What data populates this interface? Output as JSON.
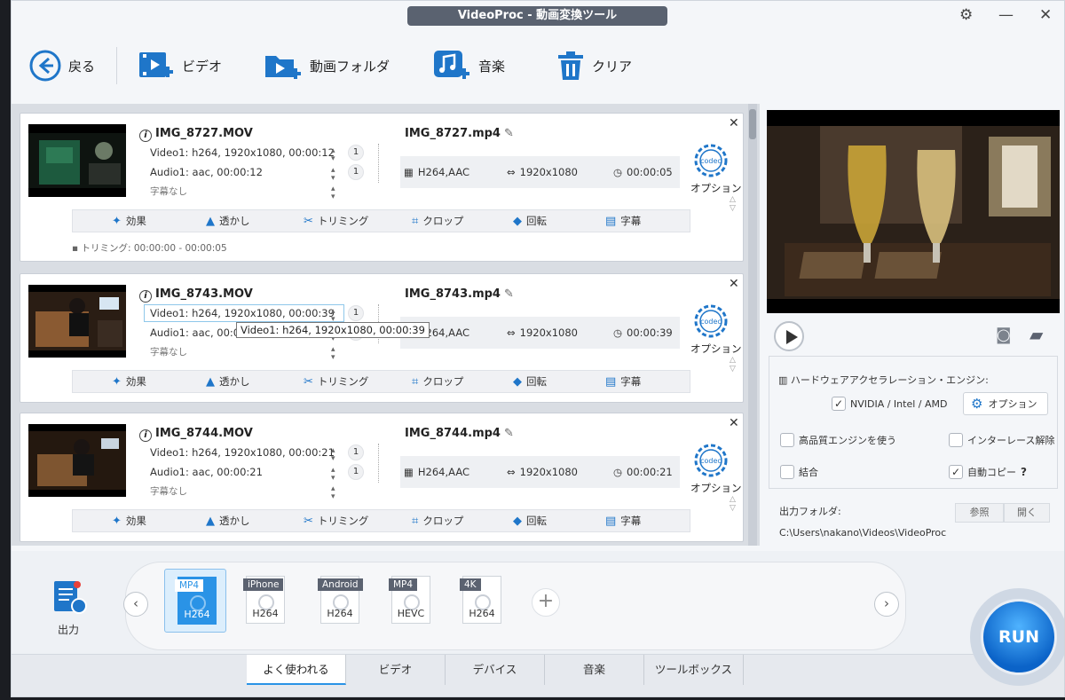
{
  "window": {
    "title": "VideoProc - 動画変換ツール"
  },
  "toolbar": {
    "back": "戻る",
    "video": "ビデオ",
    "folder": "動画フォルダ",
    "music": "音楽",
    "clear": "クリア"
  },
  "actions": {
    "effect": "効果",
    "watermark": "透かし",
    "trim": "トリミング",
    "crop": "クロップ",
    "rotate": "回転",
    "subtitle": "字幕"
  },
  "option_label": "オプション",
  "items": [
    {
      "src_name": "IMG_8727.MOV",
      "video": "Video1: h264, 1920x1080, 00:00:12",
      "audio": "Audio1: aac, 00:00:12",
      "subs": "字幕なし",
      "video_count": "1",
      "audio_count": "1",
      "out_name": "IMG_8727.mp4",
      "codec": "H264,AAC",
      "resolution": "1920x1080",
      "duration": "00:00:05",
      "trim_note": "トリミング: 00:00:00 - 00:00:05"
    },
    {
      "src_name": "IMG_8743.MOV",
      "video": "Video1: h264, 1920x1080, 00:00:39",
      "audio": "Audio1: aac, 00:00:39",
      "subs": "字幕なし",
      "video_count": "1",
      "audio_count": "1",
      "out_name": "IMG_8743.mp4",
      "codec": "H264,AAC",
      "resolution": "1920x1080",
      "duration": "00:00:39",
      "tooltip": "Video1: h264, 1920x1080, 00:00:39"
    },
    {
      "src_name": "IMG_8744.MOV",
      "video": "Video1: h264, 1920x1080, 00:00:21",
      "audio": "Audio1: aac, 00:00:21",
      "subs": "字幕なし",
      "video_count": "1",
      "audio_count": "1",
      "out_name": "IMG_8744.mp4",
      "codec": "H264,AAC",
      "resolution": "1920x1080",
      "duration": "00:00:21"
    }
  ],
  "settings": {
    "hw_title": "ハードウェアアクセラレーション・エンジン:",
    "hw_vendor": "NVIDIA / Intel / AMD",
    "hw_checked": true,
    "option": "オプション",
    "hq_engine": "高品質エンジンを使う",
    "deinterlace": "インターレース解除",
    "merge": "結合",
    "auto_copy": "自動コピー",
    "auto_copy_help": "?",
    "output_folder_label": "出力フォルダ:",
    "browse": "参照",
    "open": "開く",
    "output_path": "C:\\Users\\nakano\\Videos\\VideoProc"
  },
  "bottom": {
    "output_label": "出力",
    "presets": [
      {
        "tag": "MP4",
        "sub": "H264",
        "selected": true
      },
      {
        "tag": "iPhone",
        "sub": "H264"
      },
      {
        "tag": "Android",
        "sub": "H264"
      },
      {
        "tag": "MP4",
        "sub": "HEVC"
      },
      {
        "tag": "4K",
        "sub": "H264"
      }
    ],
    "tabs": [
      "よく使われる",
      "ビデオ",
      "デバイス",
      "音楽",
      "ツールボックス"
    ],
    "active_tab": "よく使われる",
    "run": "RUN"
  },
  "colors": {
    "accent": "#2a93e6",
    "icon_blue": "#1f76c9"
  }
}
